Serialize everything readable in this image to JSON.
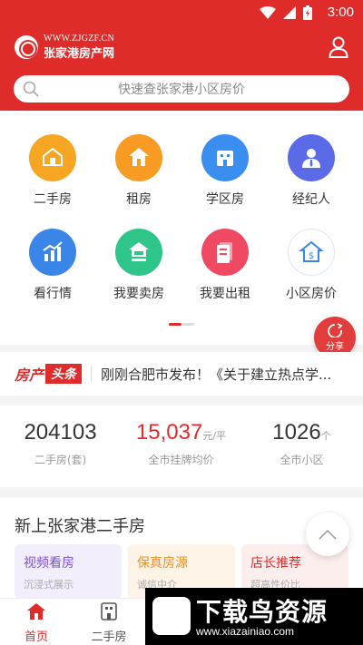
{
  "status": {
    "time": "3:00"
  },
  "header": {
    "logo_url": "WWW.ZJGZF.CN",
    "logo_name": "张家港房产网"
  },
  "search": {
    "placeholder": "快速查张家港小区房价"
  },
  "grid": {
    "items": [
      {
        "label": "二手房",
        "icon": "house-hand-icon",
        "color": "#f6a623"
      },
      {
        "label": "租房",
        "icon": "house-rent-icon",
        "color": "#f89b22"
      },
      {
        "label": "学区房",
        "icon": "school-building-icon",
        "color": "#3a8ef0"
      },
      {
        "label": "经纪人",
        "icon": "agent-icon",
        "color": "#5b6be8"
      },
      {
        "label": "看行情",
        "icon": "trend-chart-icon",
        "color": "#3a86e8"
      },
      {
        "label": "我要卖房",
        "icon": "sell-house-icon",
        "color": "#2ec58a"
      },
      {
        "label": "我要出租",
        "icon": "lease-document-icon",
        "color": "#f04a63"
      },
      {
        "label": "小区房价",
        "icon": "house-price-icon",
        "color": "#ffffff"
      }
    ]
  },
  "share": {
    "label": "分享"
  },
  "news": {
    "logo_a": "房产",
    "logo_b": "头条",
    "text": "刚刚合肥市发布！《关于建立热点学..."
  },
  "stats": [
    {
      "value": "204103",
      "unit": "",
      "label": "二手房(套)"
    },
    {
      "value": "15,037",
      "unit": "元/平",
      "label": "全市挂牌均价"
    },
    {
      "value": "1026",
      "unit": "个",
      "label": "全市小区"
    }
  ],
  "new_section": {
    "title": "新上张家港二手房",
    "features": [
      {
        "title": "视频看房",
        "sub": "沉浸式展示",
        "color": "#7b4fd6",
        "bg": "#f2eefb"
      },
      {
        "title": "保真房源",
        "sub": "诚信中介",
        "color": "#e8902a",
        "bg": "#fdf3e6"
      },
      {
        "title": "店长推荐",
        "sub": "超高性价比",
        "color": "#e02b2b",
        "bg": "#fdeeee"
      }
    ]
  },
  "tabbar": {
    "tabs": [
      {
        "label": "首页",
        "icon": "home-icon",
        "active": true
      },
      {
        "label": "二手房",
        "icon": "building-icon",
        "active": false
      }
    ]
  },
  "watermark": {
    "cn": "下载鸟资源",
    "url": "www.xiazainiao.com"
  },
  "colors": {
    "brand": "#e02b2b",
    "muted": "#999999"
  }
}
